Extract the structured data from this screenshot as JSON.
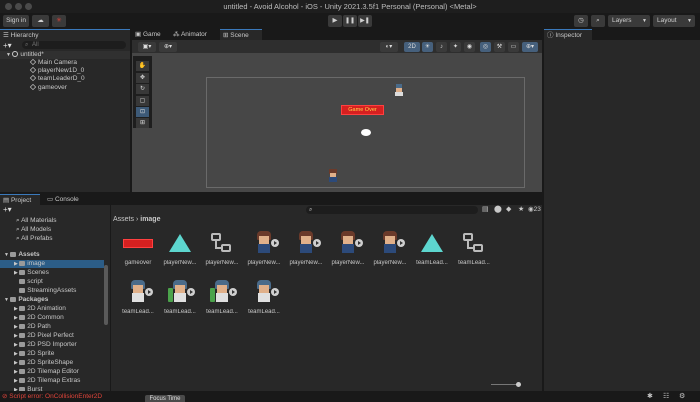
{
  "window": {
    "title": "untitled - Avoid Alcohol - iOS - Unity 2021.3.5f1 Personal (Personal) <Metal>"
  },
  "toolbar": {
    "sign_in": "Sign in",
    "layers": "Layers",
    "layout": "Layout"
  },
  "hierarchy": {
    "tab": "Hierarchy",
    "search_placeholder": "All",
    "scene": "untitled*",
    "items": [
      "Main Camera",
      "playerNew1D_0",
      "teamLeaderD_0",
      "gameover"
    ]
  },
  "center_tabs": {
    "game": "Game",
    "animator": "Animator",
    "scene": "Scene"
  },
  "scene_toolbar": {
    "mode_2d": "2D"
  },
  "scene_view": {
    "game_over_text": "Game Over"
  },
  "inspector": {
    "tab": "Inspector"
  },
  "bottom_tabs": {
    "project": "Project",
    "console": "Console"
  },
  "project": {
    "favorites": [
      "All Materials",
      "All Models",
      "All Prefabs"
    ],
    "assets_root": "Assets",
    "assets_children": [
      "image",
      "Scenes",
      "script",
      "StreamingAssets"
    ],
    "packages_root": "Packages",
    "packages": [
      "2D Animation",
      "2D Common",
      "2D Path",
      "2D Pixel Perfect",
      "2D PSD Importer",
      "2D Sprite",
      "2D SpriteShape",
      "2D Tilemap Editor",
      "2D Tilemap Extras",
      "Burst"
    ],
    "breadcrumb_root": "Assets",
    "breadcrumb_current": "image",
    "count_badge": "23",
    "asset_labels": [
      "gameover",
      "playerNew...",
      "playerNew...",
      "playerNew...",
      "playerNew...",
      "playerNew...",
      "playerNew...",
      "teamLead...",
      "teamLead...",
      "teamLead...",
      "teamLead...",
      "teamLead...",
      "teamLead..."
    ]
  },
  "status": {
    "error": "Script error: OnCollisionEnter2D",
    "bottom_button": "Focus Time"
  },
  "colors": {
    "accent": "#3a79bb",
    "selection": "#2c5d87",
    "error": "#e0443a",
    "red_banner": "#d62020"
  }
}
